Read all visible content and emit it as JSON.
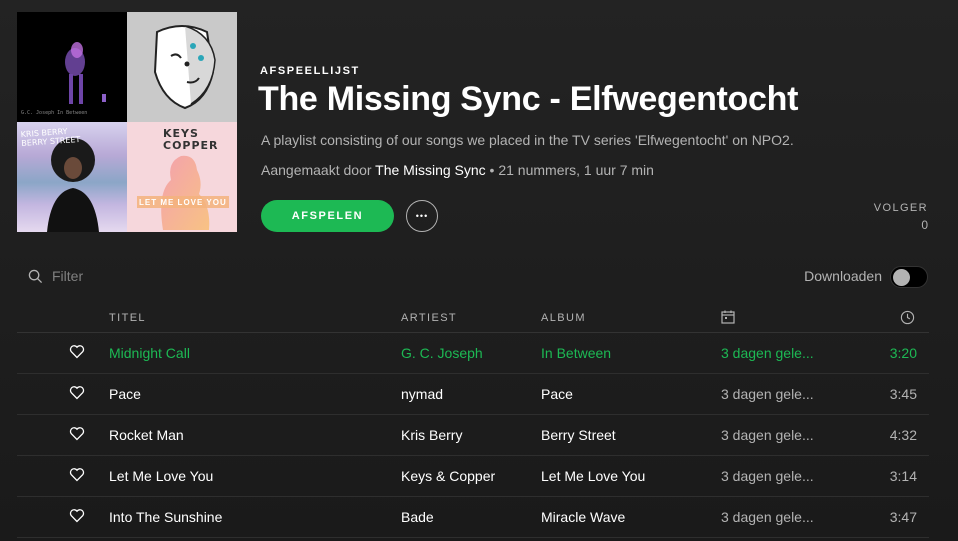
{
  "header": {
    "type_label": "AFSPEELLIJST",
    "title": "The Missing Sync - Elfwegentocht",
    "description": "A playlist consisting of our songs we placed in the TV series 'Elfwegentocht' on NPO2.",
    "created_by_label": "Aangemaakt door",
    "owner": "The Missing Sync",
    "stats": " • 21 nummers, 1 uur 7 min",
    "play_label": "AFSPELEN",
    "more_label": "•••",
    "followers_label": "VOLGER",
    "followers_count": "0"
  },
  "cover": {
    "tile1_text": "G.C. Joseph\nIn Between",
    "tile3_text": "KRIS BERRY\nBERRY STREET",
    "tile4_brand": "KEYS\nCOPPER",
    "tile4_text": "LET ME LOVE YOU"
  },
  "toolbar": {
    "filter_placeholder": "Filter",
    "download_label": "Downloaden",
    "download_enabled": false
  },
  "table": {
    "columns": {
      "title": "TITEL",
      "artist": "ARTIEST",
      "album": "ALBUM",
      "date_icon": "calendar-icon",
      "duration_icon": "clock-icon"
    },
    "rows": [
      {
        "title": "Midnight Call",
        "artist": "G. C. Joseph",
        "album": "In Between",
        "added": "3 dagen gele...",
        "duration": "3:20",
        "playing": true
      },
      {
        "title": "Pace",
        "artist": "nymad",
        "album": "Pace",
        "added": "3 dagen gele...",
        "duration": "3:45",
        "playing": false
      },
      {
        "title": "Rocket Man",
        "artist": "Kris Berry",
        "album": "Berry Street",
        "added": "3 dagen gele...",
        "duration": "4:32",
        "playing": false
      },
      {
        "title": "Let Me Love You",
        "artist": "Keys & Copper",
        "album": "Let Me Love You",
        "added": "3 dagen gele...",
        "duration": "3:14",
        "playing": false
      },
      {
        "title": "Into The Sunshine",
        "artist": "Bade",
        "album": "Miracle Wave",
        "added": "3 dagen gele...",
        "duration": "3:47",
        "playing": false
      }
    ]
  },
  "colors": {
    "accent": "#1db954",
    "background": "#1c1c1c",
    "text_secondary": "#b3b3b3"
  }
}
